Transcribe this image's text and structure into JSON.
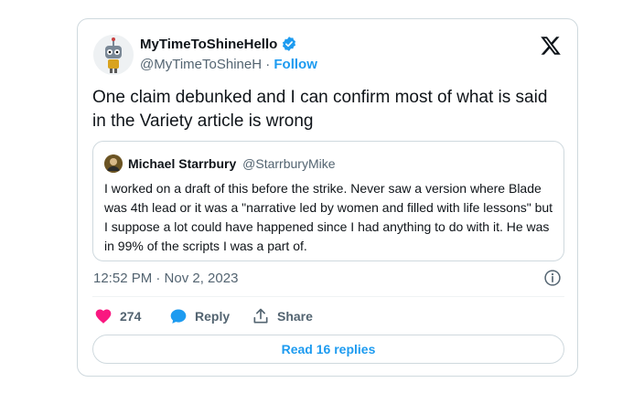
{
  "author": {
    "name": "MyTimeToShineHello",
    "handle": "@MyTimeToShineH",
    "separator": "·",
    "follow_label": "Follow"
  },
  "tweet": {
    "text": "One claim debunked and I can confirm most of what is said in the Variety article is wrong",
    "timestamp": "12:52 PM · Nov 2, 2023"
  },
  "quoted": {
    "name": "Michael Starrbury",
    "handle": "@StarrburyMike",
    "text": "I worked on a draft of this before the strike. Never saw a version where Blade was 4th lead or it was a \"narrative led by women and filled with life lessons\" but I suppose a lot could have happened since I had anything to do with it. He was in 99% of the scripts I was a part of."
  },
  "actions": {
    "like_count": "274",
    "reply_label": "Reply",
    "share_label": "Share"
  },
  "replies_button": "Read 16 replies",
  "colors": {
    "accent": "#1d9bf0",
    "like": "#f91880",
    "muted_text": "#536471",
    "border": "#cfd9de"
  },
  "icons": [
    "verified-badge-icon",
    "x-logo-icon",
    "info-icon",
    "heart-icon",
    "reply-bubble-icon",
    "share-icon"
  ]
}
